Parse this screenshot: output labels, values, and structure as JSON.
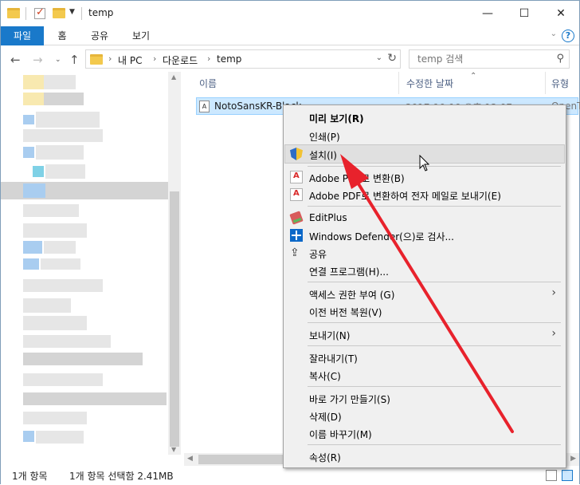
{
  "window": {
    "title": "temp",
    "minimize_glyph": "—",
    "maximize_glyph": "☐",
    "close_glyph": "✕"
  },
  "ribbon": {
    "tabs": [
      {
        "label": "파일"
      },
      {
        "label": "홈"
      },
      {
        "label": "공유"
      },
      {
        "label": "보기"
      }
    ],
    "help_glyph": "?"
  },
  "address_bar": {
    "breadcrumbs": [
      "내 PC",
      "다운로드",
      "temp"
    ],
    "search_placeholder": "temp 검색"
  },
  "file_list": {
    "columns": [
      "이름",
      "수정한 날짜",
      "유형"
    ],
    "rows": [
      {
        "name": "NotoSansKR-Black",
        "date": "2017-10-19 오후 12:07",
        "type": "OpenT"
      }
    ]
  },
  "status_bar": {
    "item_count": "1개 항목",
    "selection": "1개 항목 선택함 2.41MB"
  },
  "context_menu": {
    "items": [
      {
        "label": "미리 보기(R)",
        "icon": "none",
        "bold": true
      },
      {
        "label": "인쇄(P)",
        "icon": "none"
      },
      {
        "label": "설치(I)",
        "icon": "uac-shield-icon",
        "highlighted": true
      },
      {
        "label": "Adobe PDF로 변환(B)",
        "icon": "adobe-pdf-icon"
      },
      {
        "label": "Adobe PDF로 변환하여 전자 메일로 보내기(E)",
        "icon": "adobe-pdf-mail-icon"
      },
      {
        "label": "EditPlus",
        "icon": "editplus-icon"
      },
      {
        "label": "Windows Defender(으)로 검사...",
        "icon": "windows-defender-icon"
      },
      {
        "label": "공유",
        "icon": "share-icon"
      },
      {
        "label": "연결 프로그램(H)...",
        "icon": "none"
      },
      {
        "label": "액세스 권한 부여 (G)",
        "icon": "none",
        "submenu": true
      },
      {
        "label": "이전 버전 복원(V)",
        "icon": "none"
      },
      {
        "label": "보내기(N)",
        "icon": "none",
        "submenu": true
      },
      {
        "label": "잘라내기(T)",
        "icon": "none"
      },
      {
        "label": "복사(C)",
        "icon": "none"
      },
      {
        "label": "바로 가기 만들기(S)",
        "icon": "none"
      },
      {
        "label": "삭제(D)",
        "icon": "none"
      },
      {
        "label": "이름 바꾸기(M)",
        "icon": "none"
      },
      {
        "label": "속성(R)",
        "icon": "none"
      }
    ]
  },
  "colors": {
    "file_tab_blue": "#1979ca",
    "selection_bg": "#cce8ff",
    "menu_bg": "#f0f0f0",
    "annotation_red": "#e8222c"
  }
}
